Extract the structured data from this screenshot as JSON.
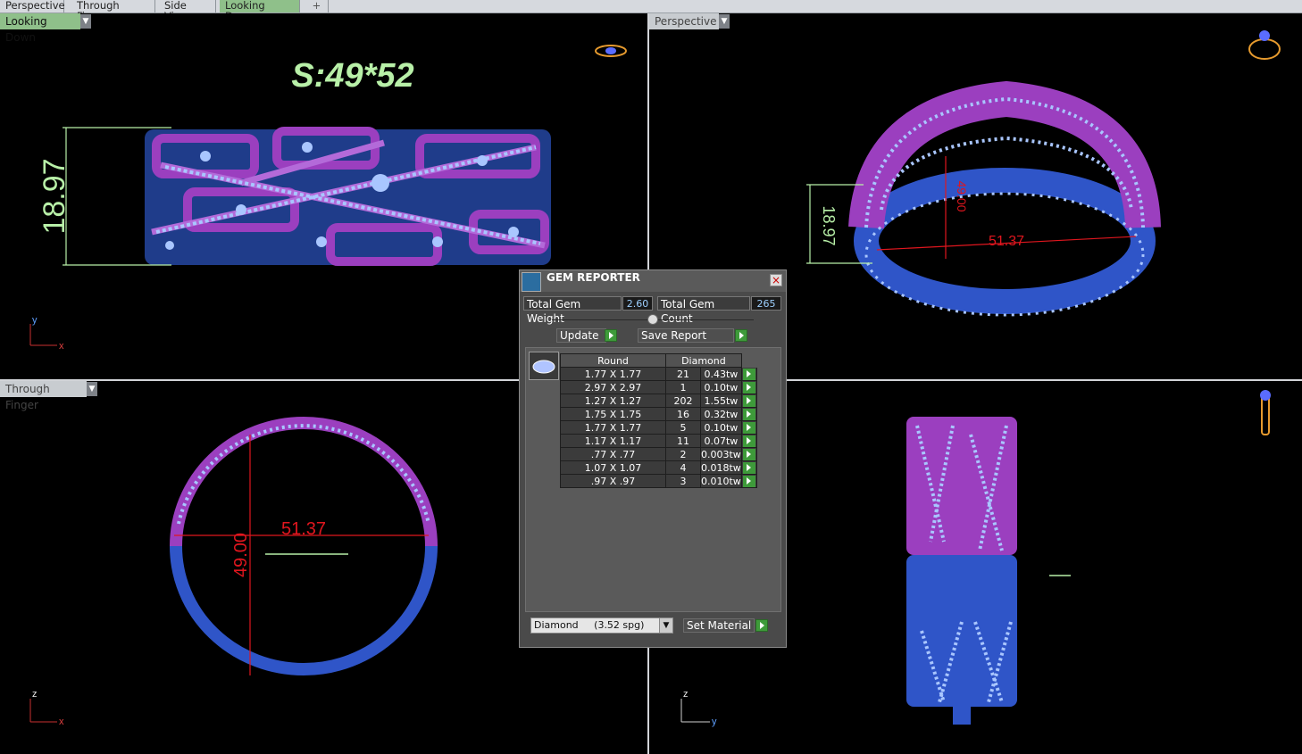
{
  "tabs": [
    "Perspective",
    "Through Finger",
    "Side View",
    "Looking Down",
    "+"
  ],
  "viewports": {
    "top_left": {
      "label": "Looking Down",
      "annotation": "S:49*52",
      "height_dim": "18.97",
      "axis_x": "x",
      "axis_y": "y"
    },
    "top_right": {
      "label": "Perspective",
      "height_dim": "18.97",
      "width_dim": "51.37",
      "depth_dim": "49.00"
    },
    "bottom_left": {
      "label": "Through Finger",
      "width_dim": "51.37",
      "height_dim": "49.00",
      "axis_x": "x",
      "axis_z": "z"
    },
    "bottom_right": {
      "axis_y": "y",
      "axis_z": "z"
    }
  },
  "gem_reporter": {
    "title": "GEM REPORTER",
    "total_weight_label": "Total Gem Weight",
    "total_weight_value": "2.60",
    "total_count_label": "Total Gem Count",
    "total_count_value": "265",
    "update_label": "Update",
    "save_report_label": "Save Report",
    "col_shape": "Round",
    "col_material": "Diamond",
    "rows": [
      {
        "size": "1.77 X 1.77",
        "count": "21",
        "weight": "0.43tw"
      },
      {
        "size": "2.97 X 2.97",
        "count": "1",
        "weight": "0.10tw"
      },
      {
        "size": "1.27 X 1.27",
        "count": "202",
        "weight": "1.55tw"
      },
      {
        "size": "1.75 X 1.75",
        "count": "16",
        "weight": "0.32tw"
      },
      {
        "size": "1.77 X 1.77",
        "count": "5",
        "weight": "0.10tw"
      },
      {
        "size": "1.17 X 1.17",
        "count": "11",
        "weight": "0.07tw"
      },
      {
        "size": ".77 X .77",
        "count": "2",
        "weight": "0.003tw"
      },
      {
        "size": "1.07 X 1.07",
        "count": "4",
        "weight": "0.018tw"
      },
      {
        "size": ".97 X .97",
        "count": "3",
        "weight": "0.010tw"
      }
    ],
    "material_select": "Diamond     (3.52 spg)",
    "set_material_label": "Set Material"
  },
  "colors": {
    "metal_purple": "#9b3fbf",
    "metal_blue": "#2f55c8",
    "gem": "#a9c6ff",
    "dim_green": "#b8f0a8",
    "dim_red": "#e0161e"
  }
}
